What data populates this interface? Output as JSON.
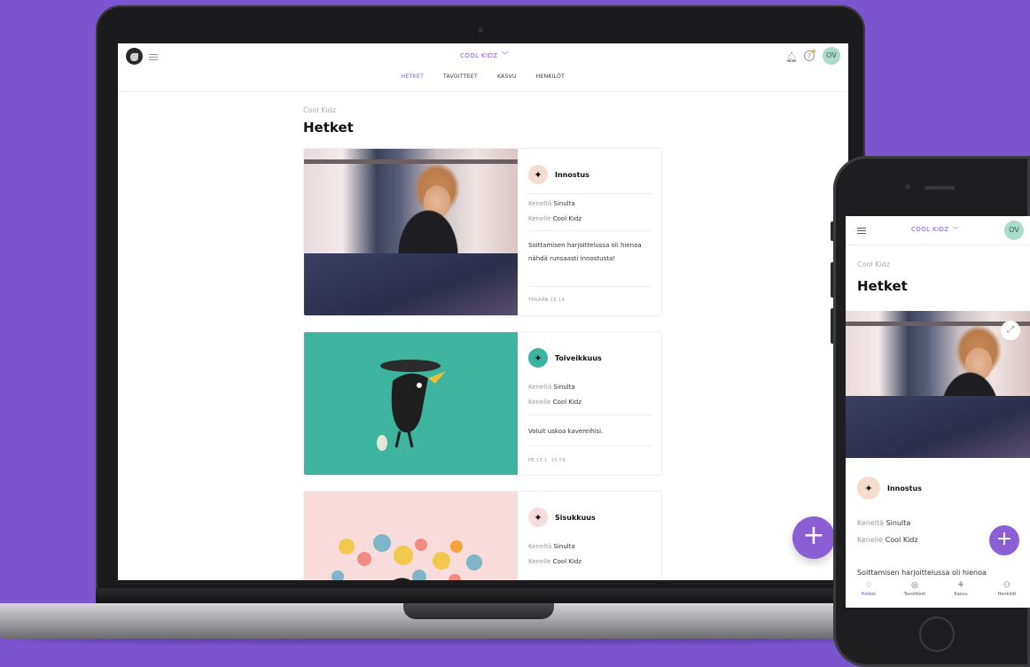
{
  "desktop": {
    "header": {
      "group_name": "COOL KIDZ",
      "chevron": "﹀",
      "user_initials": "OV",
      "help_glyph": "?"
    },
    "tabs": [
      {
        "label": "HETKET",
        "active": true
      },
      {
        "label": "TAVOITTEET",
        "active": false
      },
      {
        "label": "KASVU",
        "active": false
      },
      {
        "label": "HENKILÖT",
        "active": false
      }
    ],
    "breadcrumb": "Cool Kidz",
    "page_title": "Hetket",
    "moments": [
      {
        "value": "Innostus",
        "from_label": "Keneltä",
        "from": "Sinulta",
        "to_label": "Kenelle",
        "to": "Cool Kidz",
        "note": "Soittamisen harjoittelussa oli hienoa nähdä runsaasti innostusta!",
        "time": "TÄNÄÄN 16.14",
        "image": "photo"
      },
      {
        "value": "Toiveikkuus",
        "from_label": "Keneltä",
        "from": "Sinulta",
        "to_label": "Kenelle",
        "to": "Cool Kidz",
        "note": "Voluit uskoa kavereihisi.",
        "time": "PE 15.1. 15.59",
        "image": "teal-illustration"
      },
      {
        "value": "Sisukkuus",
        "from_label": "Keneltä",
        "from": "Sinulta",
        "to_label": "Kenelle",
        "to": "Cool Kidz",
        "note": "",
        "time": "",
        "image": "balloon-illustration"
      }
    ],
    "fab_glyph": "+"
  },
  "mobile": {
    "group_name": "COOL KIDZ",
    "chevron": "﹀",
    "user_initials": "OV",
    "breadcrumb": "Cool Kidz",
    "page_title": "Hetket",
    "expand_glyph": "⤢",
    "moment": {
      "value": "Innostus",
      "from_label": "Keneltä",
      "from": "Sinulta",
      "to_label": "Kenelle",
      "to": "Cool Kidz",
      "note": "Soittamisen harjoittelussa oli hienoa"
    },
    "fab_glyph": "+",
    "bottom_nav": [
      {
        "label": "Hetket",
        "icon": "gem-icon",
        "glyph": "♢",
        "active": true
      },
      {
        "label": "Tavoitteet",
        "icon": "target-icon",
        "glyph": "◎",
        "active": false
      },
      {
        "label": "Kasvu",
        "icon": "growth-icon",
        "glyph": "⚘",
        "active": false
      },
      {
        "label": "Henkilöt",
        "icon": "people-icon",
        "glyph": "⚇",
        "active": false
      }
    ]
  },
  "colors": {
    "background": "#7b55cf",
    "accent": "#8a5fd6",
    "teal": "#3db49e",
    "pink": "#f8dcdc"
  }
}
